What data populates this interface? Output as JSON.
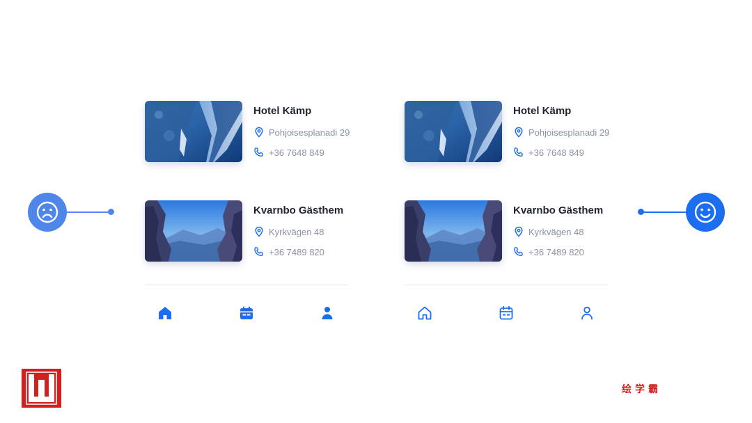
{
  "left_screen": {
    "cards": [
      {
        "name": "Hotel Kämp",
        "address": "Pohjoisesplanadi 29",
        "phone": "+36 7648 849",
        "image": "ice-cave-photo"
      },
      {
        "name": "Kvarnbo Gästhem",
        "address": "Kyrkvägen 48",
        "phone": "+36 7489 820",
        "image": "mountain-valley-photo"
      }
    ],
    "nav": [
      {
        "icon": "home-icon",
        "style": "filled"
      },
      {
        "icon": "calendar-icon",
        "style": "filled"
      },
      {
        "icon": "user-icon",
        "style": "filled"
      }
    ]
  },
  "right_screen": {
    "cards": [
      {
        "name": "Hotel Kämp",
        "address": "Pohjoisesplanadi 29",
        "phone": "+36 7648 849",
        "image": "ice-cave-photo"
      },
      {
        "name": "Kvarnbo Gästhem",
        "address": "Kyrkvägen 48",
        "phone": "+36 7489 820",
        "image": "mountain-valley-photo"
      }
    ],
    "nav": [
      {
        "icon": "home-icon",
        "style": "outline"
      },
      {
        "icon": "calendar-icon",
        "style": "outline"
      },
      {
        "icon": "user-icon",
        "style": "outline"
      }
    ]
  },
  "indicators": {
    "left": {
      "icon": "sad-face-icon",
      "color": "#4f86ea"
    },
    "right": {
      "icon": "happy-face-icon",
      "color": "#1c6ef0"
    }
  },
  "colors": {
    "accent": "#1c6ef0",
    "heading": "#1f2430",
    "muted": "#8a93a3",
    "brand_red": "#d21f1f"
  },
  "watermark": {
    "logo_icon": "w-logo-icon",
    "text": "绘学霸"
  }
}
